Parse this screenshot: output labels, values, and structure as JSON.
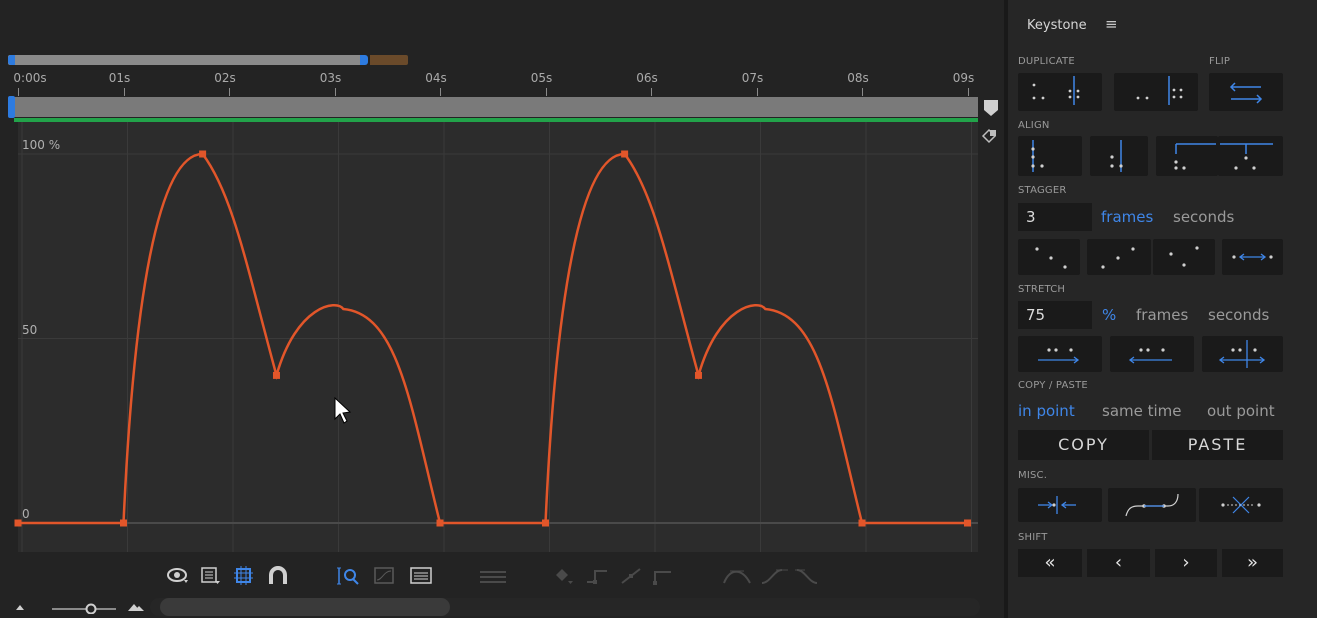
{
  "timeline": {
    "ticks": [
      "0:00s",
      "01s",
      "02s",
      "03s",
      "04s",
      "05s",
      "06s",
      "07s",
      "08s",
      "09s"
    ]
  },
  "graph": {
    "y_labels": [
      "100 %",
      "50",
      "0"
    ],
    "curve_color": "#e2562a",
    "grid_color": "#3a3a3a",
    "background": "#2c2c2c"
  },
  "chart_data": {
    "type": "line",
    "x_unit": "seconds",
    "x_range": [
      0,
      9.1
    ],
    "y_range": [
      0,
      100
    ],
    "keyframes": [
      {
        "x": 0.0,
        "y": 0
      },
      {
        "x": 1.0,
        "y": 0
      },
      {
        "x": 1.75,
        "y": 100
      },
      {
        "x": 2.45,
        "y": 40
      },
      {
        "x": 4.0,
        "y": 0
      },
      {
        "x": 5.0,
        "y": 0
      },
      {
        "x": 5.75,
        "y": 100
      },
      {
        "x": 6.45,
        "y": 40
      },
      {
        "x": 8.0,
        "y": 0
      },
      {
        "x": 9.0,
        "y": 0
      }
    ]
  },
  "toolbar": {
    "icons": [
      "eye-icon",
      "list-icon",
      "snap-frame-icon",
      "magnet-icon",
      "zoom-fit-icon",
      "graph-type-icon",
      "reference-graph-icon",
      "separate-dimensions-icon",
      "keyframe-easy-icon",
      "hold-keyframe-icon",
      "linear-keyframe-icon",
      "auto-bezier-icon",
      "ease-icon",
      "ease-in-icon",
      "ease-out-icon"
    ]
  },
  "keystone": {
    "title": "Keystone",
    "menu_icon": "≡",
    "duplicate_label": "DUPLICATE",
    "flip_label": "FLIP",
    "align_label": "ALIGN",
    "stagger": {
      "label": "STAGGER",
      "value": "3",
      "options": [
        "frames",
        "seconds"
      ],
      "selected": "frames"
    },
    "stretch": {
      "label": "STRETCH",
      "value": "75",
      "options": [
        "%",
        "frames",
        "seconds"
      ],
      "selected": "%"
    },
    "copy_paste": {
      "label": "COPY / PASTE",
      "options": [
        "in point",
        "same time",
        "out point"
      ],
      "selected": "in point",
      "copy_label": "COPY",
      "paste_label": "PASTE"
    },
    "misc_label": "MISC.",
    "shift": {
      "label": "SHIFT",
      "buttons": [
        "«",
        "‹",
        "›",
        "»"
      ]
    }
  }
}
